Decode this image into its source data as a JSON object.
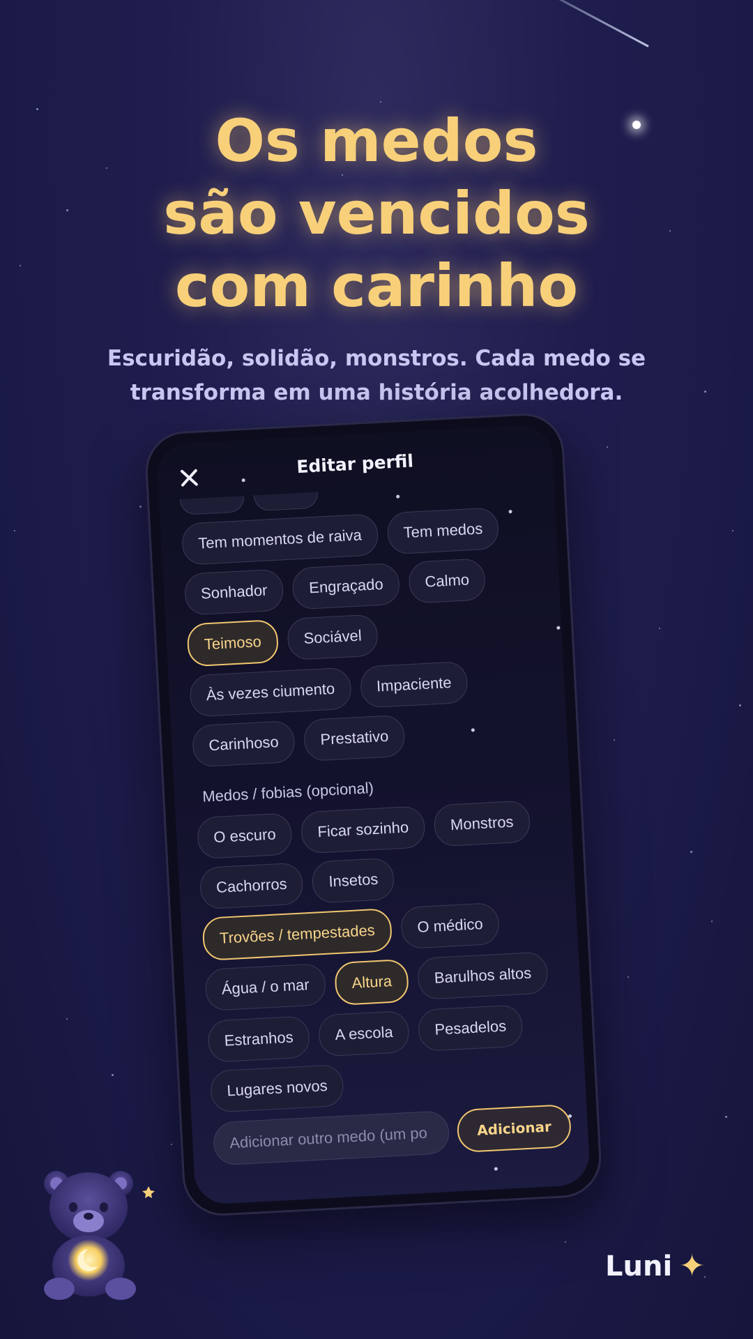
{
  "headline": [
    "Os medos",
    "são vencidos",
    "com carinho"
  ],
  "subtitle": "Escuridão, solidão, monstros. Cada medo se transforma em uma história acolhedora.",
  "phone": {
    "title": "Editar perfil",
    "close_icon": "close-icon",
    "traits": [
      {
        "label": "Tem momentos de raiva",
        "selected": false
      },
      {
        "label": "Tem medos",
        "selected": false
      },
      {
        "label": "Sonhador",
        "selected": false
      },
      {
        "label": "Engraçado",
        "selected": false
      },
      {
        "label": "Calmo",
        "selected": false
      },
      {
        "label": "Teimoso",
        "selected": true
      },
      {
        "label": "Sociável",
        "selected": false
      },
      {
        "label": "Às vezes ciumento",
        "selected": false
      },
      {
        "label": "Impaciente",
        "selected": false
      },
      {
        "label": "Carinhoso",
        "selected": false
      },
      {
        "label": "Prestativo",
        "selected": false
      }
    ],
    "fears_label": "Medos / fobias (opcional)",
    "fears": [
      {
        "label": "O escuro",
        "selected": false
      },
      {
        "label": "Ficar sozinho",
        "selected": false
      },
      {
        "label": "Monstros",
        "selected": false
      },
      {
        "label": "Cachorros",
        "selected": false
      },
      {
        "label": "Insetos",
        "selected": false
      },
      {
        "label": "Trovões / tempestades",
        "selected": true
      },
      {
        "label": "O médico",
        "selected": false
      },
      {
        "label": "Água / o mar",
        "selected": false
      },
      {
        "label": "Altura",
        "selected": true
      },
      {
        "label": "Barulhos altos",
        "selected": false
      },
      {
        "label": "Estranhos",
        "selected": false
      },
      {
        "label": "A escola",
        "selected": false
      },
      {
        "label": "Pesadelos",
        "selected": false
      },
      {
        "label": "Lugares novos",
        "selected": false
      }
    ],
    "add_placeholder": "Adicionar outro medo (um po",
    "add_button": "Adicionar"
  },
  "brand": {
    "name": "Luni",
    "icon": "sparkle-icon"
  },
  "colors": {
    "accent": "#f8d07a",
    "background": "#1f1d4d",
    "chip": "#1e1d36",
    "selected_border": "#f2c76f"
  }
}
